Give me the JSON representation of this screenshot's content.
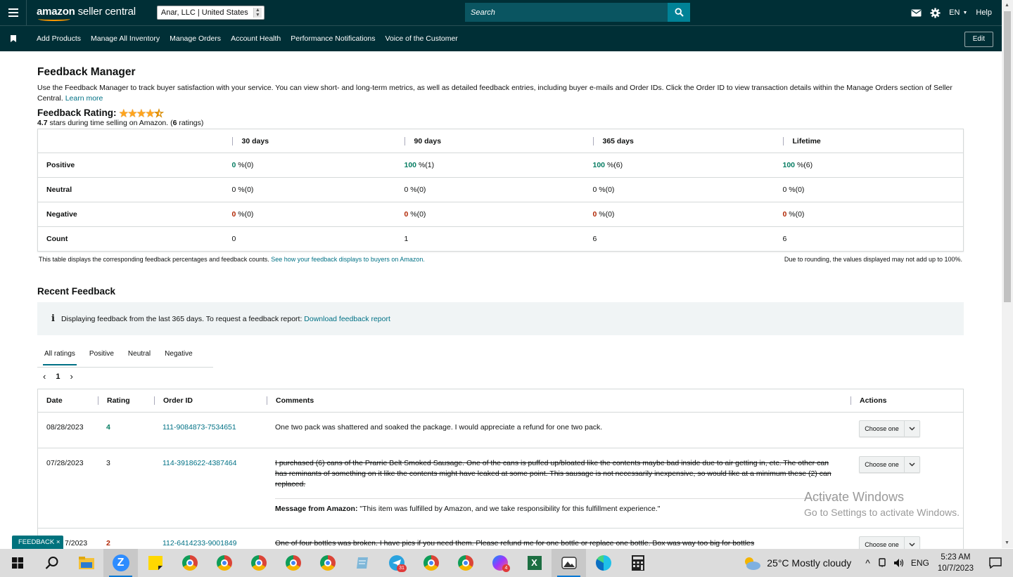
{
  "topbar": {
    "brand_a": "amazon",
    "brand_b": " seller central",
    "account": "Anar, LLC | United States",
    "search_placeholder": "Search",
    "language": "EN",
    "help": "Help"
  },
  "subnav": {
    "items": [
      "Add Products",
      "Manage All Inventory",
      "Manage Orders",
      "Account Health",
      "Performance Notifications",
      "Voice of the Customer"
    ],
    "edit": "Edit"
  },
  "page": {
    "title": "Feedback Manager",
    "description": "Use the Feedback Manager to track buyer satisfaction with your service. You can view short- and long-term metrics, as well as detailed feedback entries, including buyer e-mails and Order IDs. Click the Order ID to view transaction details within the Manage Orders section of Seller Central.",
    "learn_more": "Learn more",
    "rating_label": "Feedback Rating:",
    "rating_stars": 4.5,
    "rating_value": "4.7",
    "rating_text": " stars during time selling on Amazon. (",
    "rating_count": "6",
    "rating_text_end": " ratings)"
  },
  "metrics": {
    "columns": [
      "30 days",
      "90 days",
      "365 days",
      "Lifetime"
    ],
    "rows": [
      {
        "label": "Positive",
        "cells": [
          {
            "v": "0",
            "s": " %(0)"
          },
          {
            "v": "100",
            "s": " %(1)"
          },
          {
            "v": "100",
            "s": " %(6)"
          },
          {
            "v": "100",
            "s": " %(6)"
          }
        ]
      },
      {
        "label": "Neutral",
        "cells": [
          {
            "v": "0",
            "s": " %(0)"
          },
          {
            "v": "0",
            "s": " %(0)"
          },
          {
            "v": "0",
            "s": " %(0)"
          },
          {
            "v": "0",
            "s": " %(0)"
          }
        ]
      },
      {
        "label": "Negative",
        "cells": [
          {
            "v": "0",
            "s": " %(0)"
          },
          {
            "v": "0",
            "s": " %(0)"
          },
          {
            "v": "0",
            "s": " %(0)"
          },
          {
            "v": "0",
            "s": " %(0)"
          }
        ]
      },
      {
        "label": "Count",
        "cells": [
          {
            "v": "0",
            "s": ""
          },
          {
            "v": "1",
            "s": ""
          },
          {
            "v": "6",
            "s": ""
          },
          {
            "v": "6",
            "s": ""
          }
        ]
      }
    ],
    "note_left": "This table displays the corresponding feedback percentages and feedback counts.",
    "note_link": "See how your feedback displays to buyers on Amazon.",
    "note_right": "Due to rounding, the values displayed may not add up to 100%."
  },
  "recent": {
    "title": "Recent Feedback",
    "info": "Displaying feedback from the last 365 days. To request a feedback report:",
    "info_link": "Download feedback report",
    "tabs": [
      "All ratings",
      "Positive",
      "Neutral",
      "Negative"
    ],
    "page": "1",
    "headers": [
      "Date",
      "Rating",
      "Order ID",
      "Comments",
      "Actions"
    ],
    "action_label": "Choose one",
    "rows": [
      {
        "date": "08/28/2023",
        "rating": "4",
        "order": "111-9084873-7534651",
        "comment": "One two pack was shattered and soaked the package. I would appreciate a refund for one two pack."
      },
      {
        "date": "07/28/2023",
        "rating": "3",
        "order": "114-3918622-4387464",
        "comment": "I purchased (6) cans of the Prarrie Belt Smoked Sausage. One of the cans is puffed up/bloated like the contents maybe bad inside due to air getting in, etc. The other can has reminants of something on it like the contents might have leaked at some point. This sausage is not necessarily inexpensive, so would like at a minimum these (2) can replaced.",
        "message_label": "Message from Amazon:",
        "message": " \"This item was fulfilled by Amazon, and we take responsibility for this fulfillment experience.\""
      },
      {
        "date": "07/27/2023",
        "date_visible": "7/2023",
        "rating": "2",
        "order": "112-6414233-9001849",
        "comment": "One of four bottles was broken. I have pics if you need them. Please refund me for one bottle or replace one bottle. Box was way too big for bottles"
      }
    ]
  },
  "overlay": {
    "feedback_tab": "FEEDBACK",
    "watermark_1": "Activate Windows",
    "watermark_2": "Go to Settings to activate Windows."
  },
  "taskbar": {
    "weather": "25°C  Mostly cloudy",
    "lang": "ENG",
    "time": "5:23 AM",
    "date": "10/7/2023",
    "badges": [
      "31",
      "4"
    ]
  },
  "colors": {
    "nav": "#002f36",
    "search": "#0a5561",
    "accent": "#007185",
    "positive": "#067d62",
    "negative": "#b12704",
    "star": "#ffa41c"
  }
}
